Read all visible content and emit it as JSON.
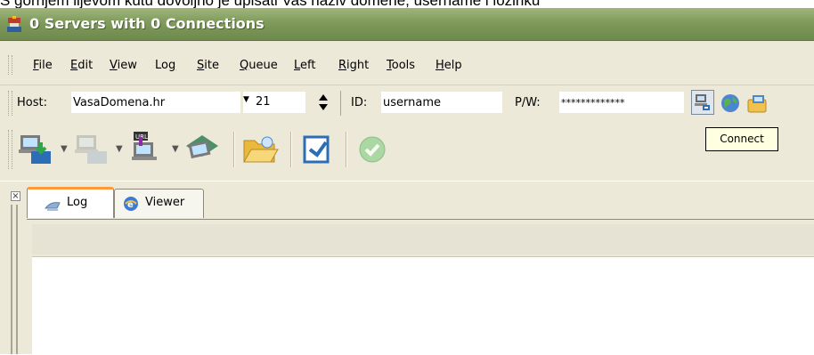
{
  "caption": "S gornjem lijevom kutu dovoljno je upisati Vaš naziv domene, username i lozinku",
  "window": {
    "title": "0 Servers with 0 Connections"
  },
  "menu": [
    {
      "label": "File",
      "accel": "F",
      "rest": "ile"
    },
    {
      "label": "Edit",
      "accel": "E",
      "rest": "dit"
    },
    {
      "label": "View",
      "accel": "V",
      "rest": "iew"
    },
    {
      "label": "Log",
      "pre": "Lo",
      "accel": "g",
      "rest": ""
    },
    {
      "label": "Site",
      "accel": "S",
      "rest": "ite"
    },
    {
      "label": "Queue",
      "accel": "Q",
      "rest": "ueue"
    },
    {
      "label": "Left",
      "accel": "L",
      "rest": "eft"
    },
    {
      "label": "Right",
      "accel": "R",
      "rest": "ight"
    },
    {
      "label": "Tools",
      "accel": "T",
      "rest": "ools"
    },
    {
      "label": "Help",
      "accel": "H",
      "rest": "elp"
    }
  ],
  "connection": {
    "host_label": "Host:",
    "host_value": "VasaDomena.hr",
    "port_value": "21",
    "id_label": "ID:",
    "id_value": "username",
    "pw_label": "P/W:",
    "pw_value": "*************"
  },
  "tooltip": "Connect",
  "tabs": [
    {
      "label": "Log",
      "icon": "log-icon",
      "active": true
    },
    {
      "label": "Viewer",
      "icon": "browser-icon",
      "active": false
    }
  ],
  "side_close": "×",
  "colors": {
    "titlebar": "#7f9a5b",
    "title_text": "#ffffff",
    "toolbar_bg": "#ece9d8",
    "tooltip_bg": "#ffffe1",
    "active_tab_accent": "#ff9a3b"
  }
}
